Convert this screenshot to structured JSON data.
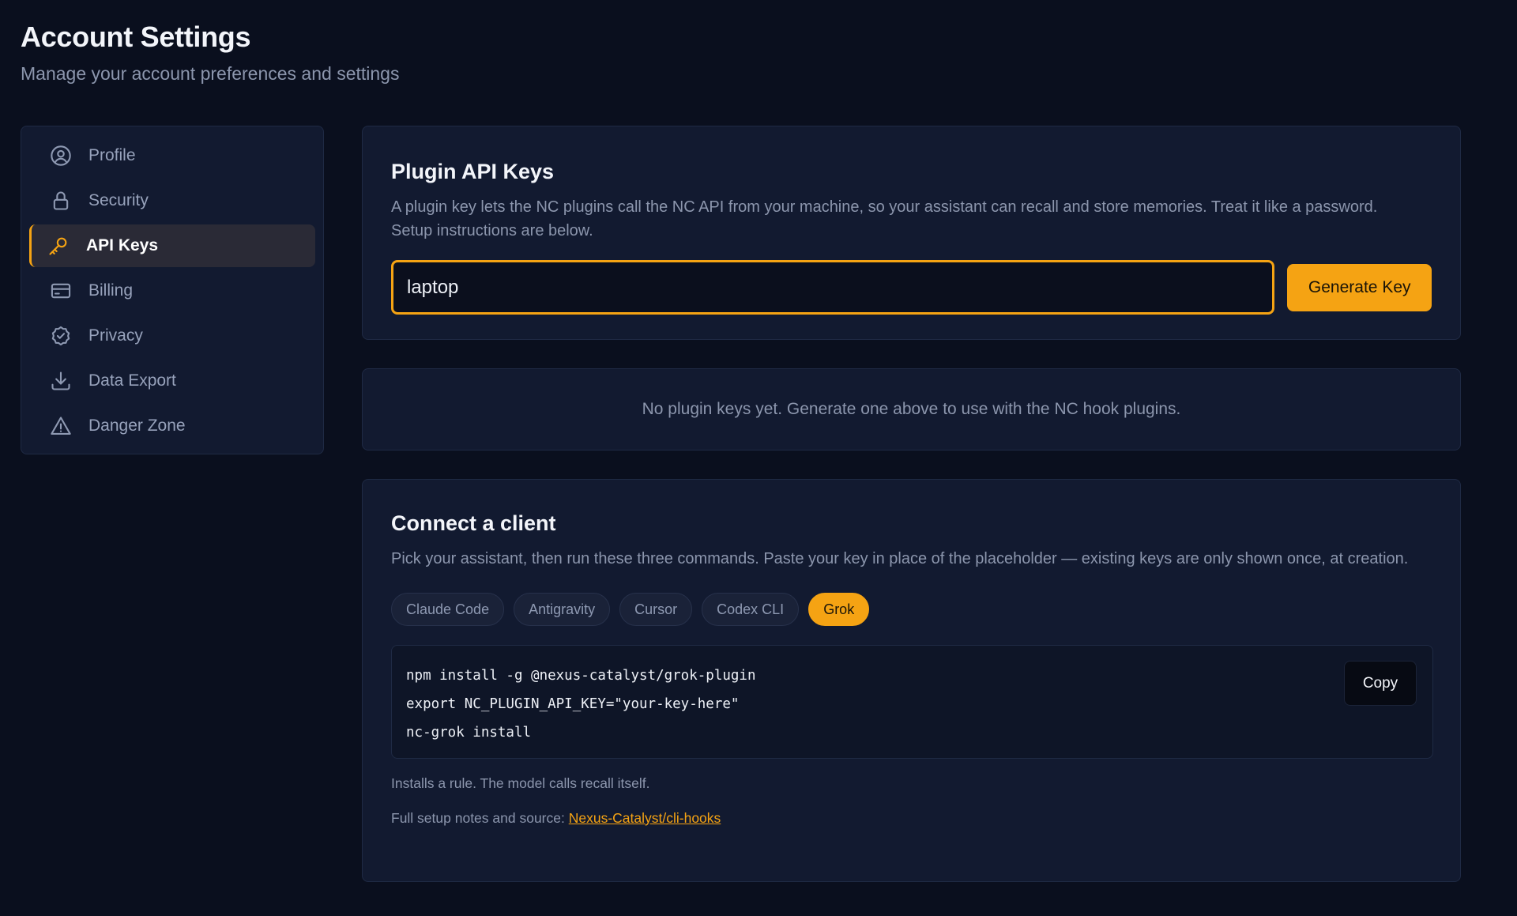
{
  "header": {
    "title": "Account Settings",
    "subtitle": "Manage your account preferences and settings"
  },
  "sidebar": {
    "items": [
      {
        "label": "Profile",
        "icon": "user-circle-icon"
      },
      {
        "label": "Security",
        "icon": "lock-icon"
      },
      {
        "label": "API Keys",
        "icon": "key-icon",
        "active": true
      },
      {
        "label": "Billing",
        "icon": "credit-card-icon"
      },
      {
        "label": "Privacy",
        "icon": "shield-check-icon"
      },
      {
        "label": "Data Export",
        "icon": "download-icon"
      },
      {
        "label": "Danger Zone",
        "icon": "warning-icon"
      }
    ]
  },
  "plugin_keys": {
    "title": "Plugin API Keys",
    "description": "A plugin key lets the NC plugins call the NC API from your machine, so your assistant can recall and store memories. Treat it like a password. Setup instructions are below.",
    "input_value": "laptop",
    "generate_label": "Generate Key"
  },
  "empty_state": {
    "text": "No plugin keys yet. Generate one above to use with the NC hook plugins."
  },
  "connect": {
    "title": "Connect a client",
    "description": "Pick your assistant, then run these three commands. Paste your key in place of the placeholder — existing keys are only shown once, at creation.",
    "tabs": [
      "Claude Code",
      "Antigravity",
      "Cursor",
      "Codex CLI",
      "Grok"
    ],
    "active_tab": "Grok",
    "code_lines": [
      "npm install -g @nexus-catalyst/grok-plugin",
      "export NC_PLUGIN_API_KEY=\"your-key-here\"",
      "nc-grok install"
    ],
    "copy_label": "Copy",
    "note": "Installs a rule. The model calls recall itself.",
    "source_prefix": "Full setup notes and source: ",
    "source_link": "Nexus-Catalyst/cli-hooks"
  },
  "colors": {
    "background": "#0a0f1e",
    "card": "#121a30",
    "accent": "#f5a313",
    "muted_text": "#8c96ad"
  }
}
